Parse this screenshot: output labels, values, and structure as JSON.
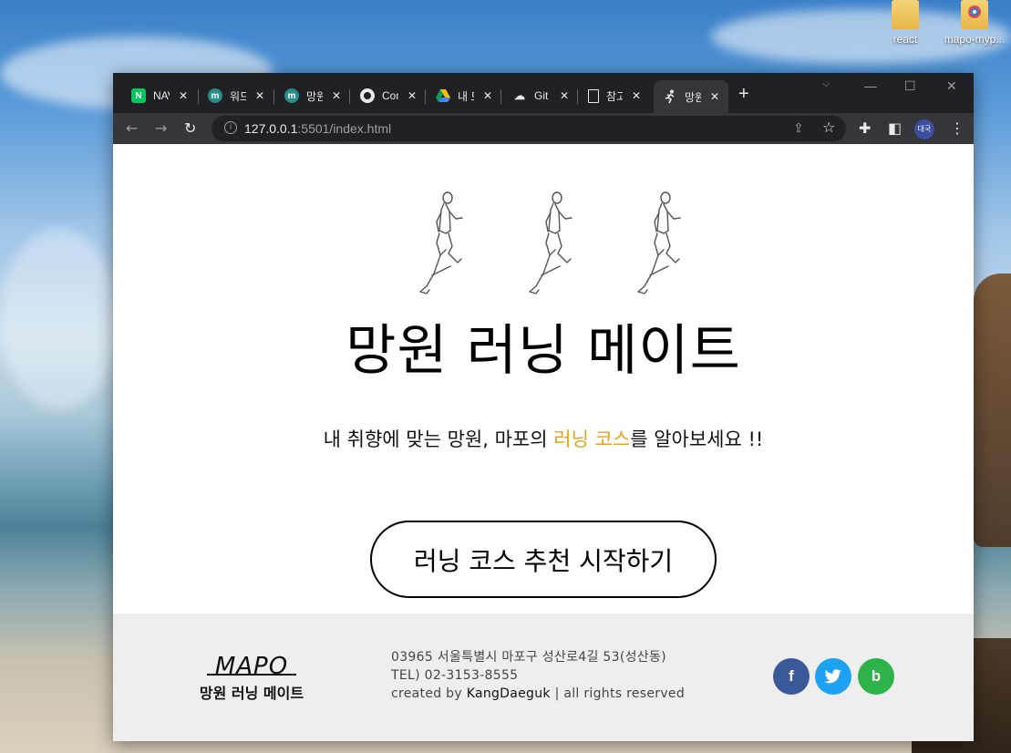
{
  "desktop": {
    "icons": [
      {
        "label": "react"
      },
      {
        "label": "mapo-myp..."
      }
    ]
  },
  "browser": {
    "tabs": [
      {
        "title": "NAVER",
        "favicon": "N"
      },
      {
        "title": "워드",
        "favicon": "m"
      },
      {
        "title": "망원",
        "favicon": "m"
      },
      {
        "title": "Con",
        "favicon": "github"
      },
      {
        "title": "내 드",
        "favicon": "drive"
      },
      {
        "title": "Git",
        "favicon": "git"
      },
      {
        "title": "참고",
        "favicon": "doc"
      },
      {
        "title": "망원",
        "favicon": "runner"
      }
    ],
    "new_tab": "+",
    "url_host": "127.0.0.1",
    "url_rest": ":5501/index.html",
    "profile": "대국"
  },
  "page": {
    "hero_title": "망원 러닝 메이트",
    "subtitle_before": "내 취향에 맞는 망원, 마포의 ",
    "subtitle_highlight": "러닝 코스",
    "subtitle_after": "를 알아보세요 !!",
    "cta_label": "러닝 코스 추천 시작하기",
    "highlight_color": "#e8a317"
  },
  "footer": {
    "logo_mark": "MAPO",
    "logo_name": "망원 러닝 메이트",
    "address": "03965 서울특별시 마포구 성산로4길 53(성산동)",
    "tel": "TEL) 02-3153-8555",
    "credit_prefix": "created by ",
    "credit_name": "KangDaeguk",
    "credit_suffix": " | all rights reserved",
    "social": [
      {
        "icon": "facebook-icon",
        "glyph": "f",
        "color": "#3b5998"
      },
      {
        "icon": "twitter-icon",
        "glyph": "t",
        "color": "#1da1f2"
      },
      {
        "icon": "blog-icon",
        "glyph": "b",
        "color": "#2db34a"
      }
    ]
  }
}
